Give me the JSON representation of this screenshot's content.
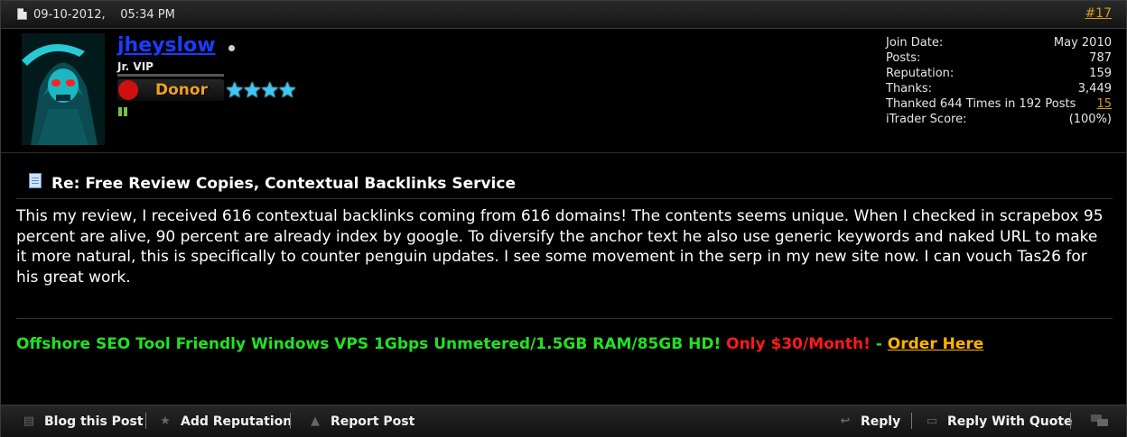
{
  "post": {
    "date": "09-10-2012,    05:34 PM",
    "number": "#17"
  },
  "user": {
    "name": "jheyslow",
    "title": "Jr. VIP",
    "donor_label": "Donor",
    "stars": "★★★★"
  },
  "stats": [
    {
      "label": "Join Date:",
      "value": "May 2010"
    },
    {
      "label": "Posts:",
      "value": "787"
    },
    {
      "label": "Reputation:",
      "value": "159"
    },
    {
      "label": "Thanks:",
      "value": "3,449"
    },
    {
      "label": "Thanked 644 Times in 192 Posts",
      "value": "15"
    },
    {
      "label": "iTrader Score:",
      "value": "(100%)"
    }
  ],
  "content": {
    "title": "Re: Free Review Copies, Contextual Backlinks Service",
    "body": "This my review, I received 616 contextual backlinks coming from 616 domains! The contents seems unique. When I checked in scrapebox 95 percent are alive, 90 percent are already index by google. To diversify the anchor text he also use generic keywords and naked URL to make it more natural, this is specifically to counter penguin updates. I see some movement in the serp in my new site now. I can vouch Tas26 for his great work."
  },
  "signature": {
    "green": "Offshore SEO Tool Friendly Windows VPS 1Gbps Unmetered/1.5GB RAM/85GB HD!",
    "red": "Only $30/Month!",
    "dash": "-",
    "link": "Order Here"
  },
  "footer": {
    "blog": "Blog this Post",
    "add_rep": "Add Reputation",
    "report": "Report Post",
    "reply": "Reply",
    "reply_quote": "Reply With Quote"
  },
  "colors": {
    "username": "#1a3cff",
    "link": "#d49a1a",
    "sig_green": "#22e122",
    "sig_red": "#ff1a1a",
    "sig_link": "#ffb300",
    "stars": "#33ccff"
  },
  "icons": [
    "document-icon",
    "online-status-icon",
    "post-title-icon",
    "blog-icon",
    "reputation-star-icon",
    "report-warning-icon",
    "reply-arrow-icon",
    "quote-bubble-icon",
    "multiquote-icon"
  ]
}
